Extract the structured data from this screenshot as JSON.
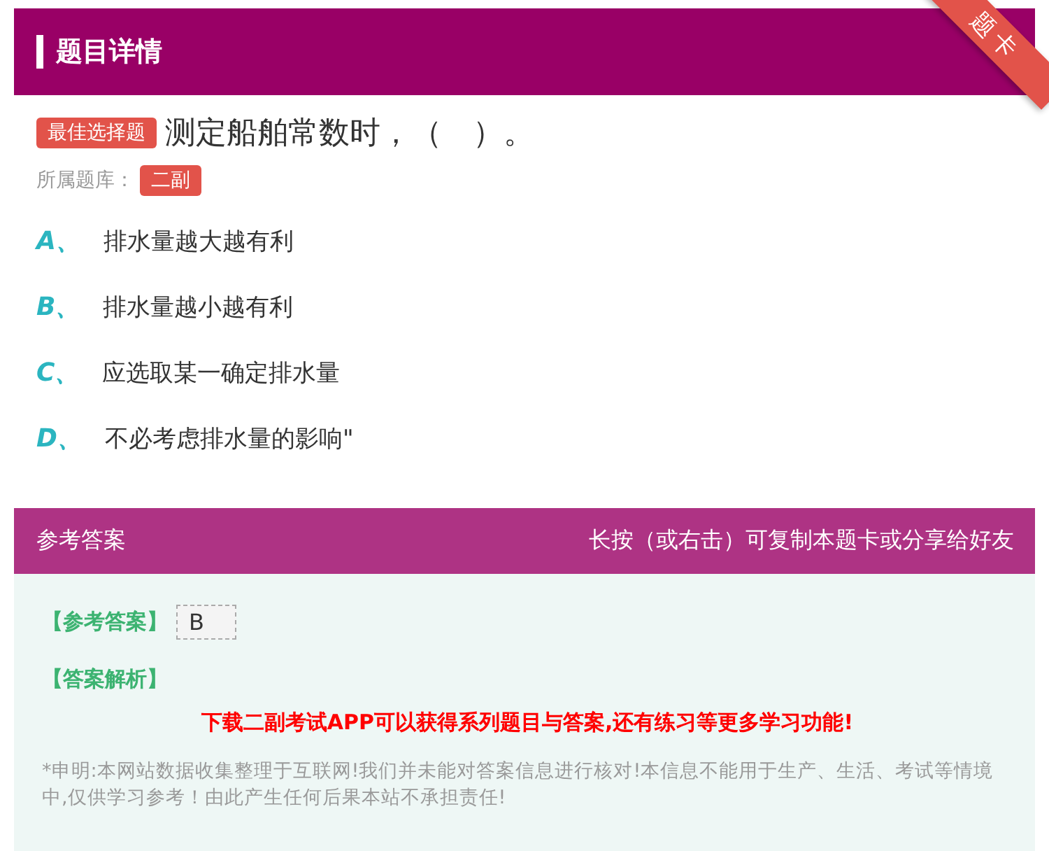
{
  "header": {
    "title": "题目详情",
    "ribbon": "题卡"
  },
  "question": {
    "type_badge": "最佳选择题",
    "text": "测定船舶常数时，（　）。",
    "bank_label": "所属题库：",
    "bank": "二副"
  },
  "options": [
    {
      "letter": "A",
      "separator": "、",
      "text": "排水量越大越有利"
    },
    {
      "letter": "B",
      "separator": "、",
      "text": "排水量越小越有利"
    },
    {
      "letter": "C",
      "separator": "、",
      "text": "应选取某一确定排水量"
    },
    {
      "letter": "D",
      "separator": "、",
      "text": "不必考虑排水量的影响\""
    }
  ],
  "answer_section": {
    "title": "参考答案",
    "hint": "长按（或右击）可复制本题卡或分享给好友",
    "answer_label": "【参考答案】",
    "answer": "B",
    "analysis_label": "【答案解析】",
    "promo": "下载二副考试APP可以获得系列题目与答案,还有练习等更多学习功能!",
    "disclaimer": "*申明:本网站数据收集整理于互联网!我们并未能对答案信息进行核对!本信息不能用于生产、生活、考试等情境中,仅供学习参考！由此产生任何后果本站不承担责任!"
  }
}
